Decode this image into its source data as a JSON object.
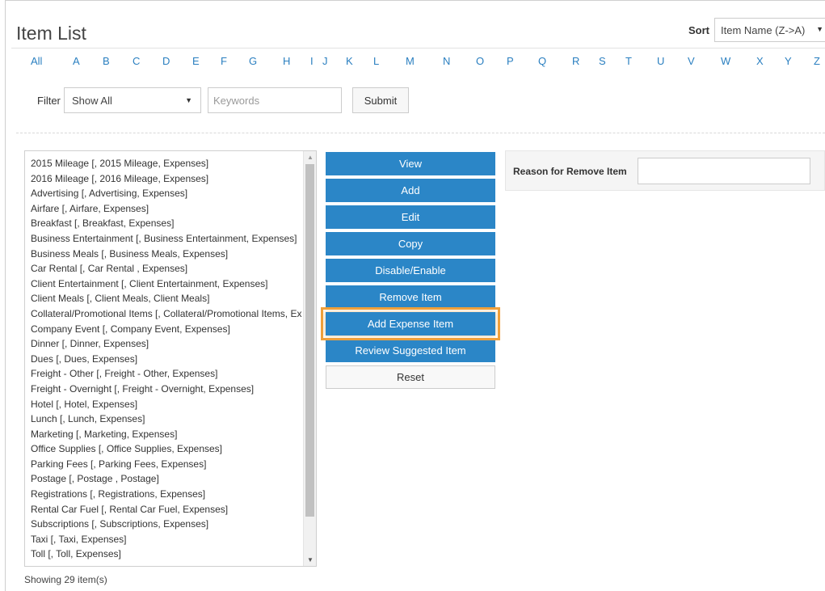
{
  "page": {
    "title": "Item List"
  },
  "sort": {
    "label": "Sort",
    "selected": "Item Name (Z->A)"
  },
  "alphabet": [
    "All",
    "A",
    "B",
    "C",
    "D",
    "E",
    "F",
    "G",
    "H",
    "I",
    "J",
    "K",
    "L",
    "M",
    "N",
    "O",
    "P",
    "Q",
    "R",
    "S",
    "T",
    "U",
    "V",
    "W",
    "X",
    "Y",
    "Z"
  ],
  "filter": {
    "label": "Filter",
    "selected": "Show All",
    "keywords_placeholder": "Keywords",
    "submit_label": "Submit"
  },
  "items": [
    "2015 Mileage [, 2015 Mileage, Expenses]",
    "2016 Mileage [, 2016 Mileage, Expenses]",
    "Advertising [, Advertising, Expenses]",
    "Airfare [, Airfare, Expenses]",
    "Breakfast [, Breakfast, Expenses]",
    "Business Entertainment [, Business Entertainment, Expenses]",
    "Business Meals [, Business Meals, Expenses]",
    "Car Rental [, Car Rental , Expenses]",
    "Client Entertainment [, Client Entertainment, Expenses]",
    "Client Meals [, Client Meals, Client Meals]",
    "Collateral/Promotional Items [, Collateral/Promotional Items, Expenses]",
    "Company Event [, Company Event, Expenses]",
    "Dinner [, Dinner, Expenses]",
    "Dues [, Dues, Expenses]",
    "Freight - Other [, Freight - Other, Expenses]",
    "Freight - Overnight [, Freight - Overnight, Expenses]",
    "Hotel [, Hotel, Expenses]",
    "Lunch [, Lunch, Expenses]",
    "Marketing [, Marketing, Expenses]",
    "Office Supplies [, Office Supplies, Expenses]",
    "Parking Fees [, Parking Fees, Expenses]",
    "Postage [, Postage , Postage]",
    "Registrations [, Registrations, Expenses]",
    "Rental Car Fuel [, Rental Car Fuel, Expenses]",
    "Subscriptions [, Subscriptions, Expenses]",
    "Taxi [, Taxi, Expenses]",
    "Toll [, Toll, Expenses]"
  ],
  "status": {
    "showing": "Showing 29 item(s)"
  },
  "actions": {
    "view": "View",
    "add": "Add",
    "edit": "Edit",
    "copy": "Copy",
    "disable_enable": "Disable/Enable",
    "remove_item": "Remove Item",
    "add_expense_item": "Add Expense Item",
    "review_suggested_item": "Review Suggested Item",
    "reset": "Reset"
  },
  "reason": {
    "label": "Reason for Remove Item",
    "value": ""
  },
  "colors": {
    "primary_button": "#2b86c7",
    "highlight": "#f0a03a",
    "link": "#2a7fc0"
  }
}
